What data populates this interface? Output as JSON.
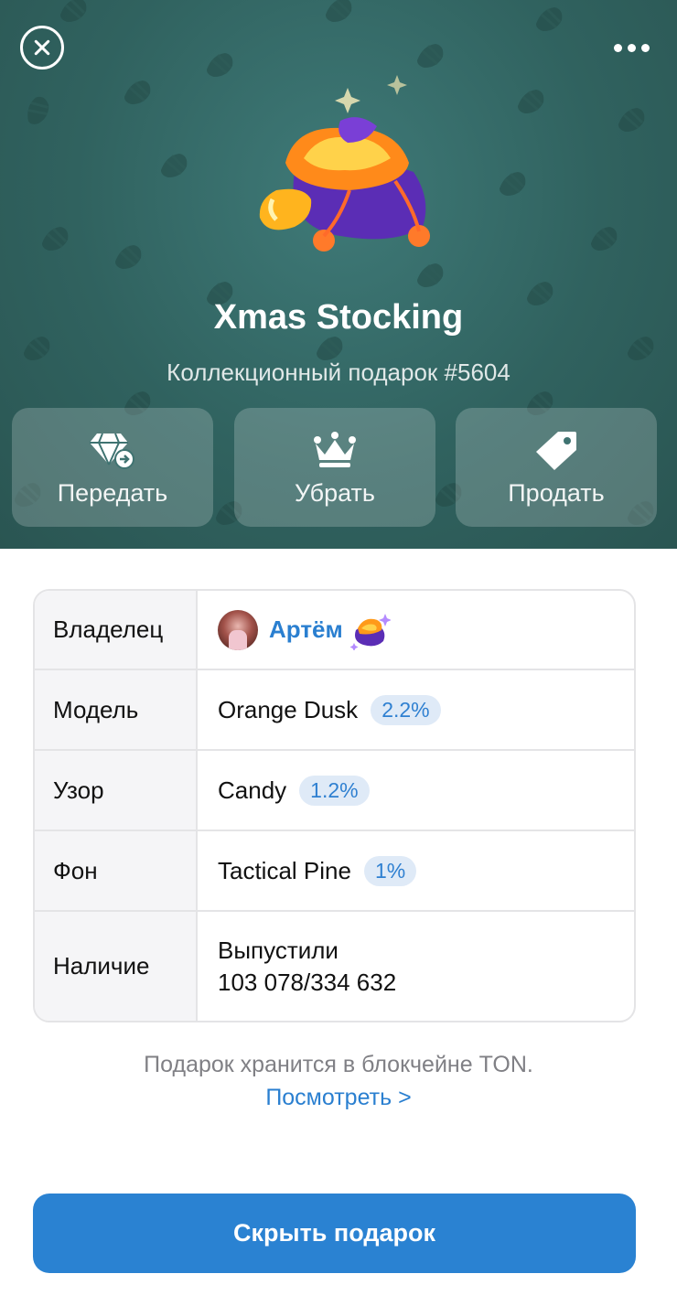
{
  "header": {
    "close_icon": "close-circle-icon",
    "more_icon": "more-horizontal-icon",
    "title": "Xmas Stocking",
    "subtitle": "Коллекционный подарок #5604",
    "background_color": "#30625f"
  },
  "actions": [
    {
      "label": "Передать",
      "icon": "diamond-transfer-icon"
    },
    {
      "label": "Убрать",
      "icon": "crown-icon"
    },
    {
      "label": "Продать",
      "icon": "price-tag-icon"
    }
  ],
  "info": {
    "owner": {
      "key": "Владелец",
      "name": "Артём"
    },
    "model": {
      "key": "Модель",
      "value": "Orange Dusk",
      "rarity": "2.2%"
    },
    "pattern": {
      "key": "Узор",
      "value": "Candy",
      "rarity": "1.2%"
    },
    "backdrop": {
      "key": "Фон",
      "value": "Tactical Pine",
      "rarity": "1%"
    },
    "availability": {
      "key": "Наличие",
      "line1": "Выпустили",
      "line2": "103 078/334 632"
    }
  },
  "footer": {
    "note": "Подарок хранится в блокчейне TON.",
    "link": "Посмотреть >"
  },
  "primary_button": {
    "label": "Скрыть подарок",
    "color": "#2a82d2"
  }
}
